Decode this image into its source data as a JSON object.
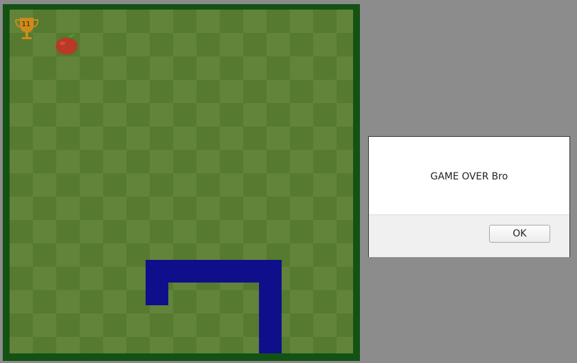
{
  "game": {
    "score": "11",
    "icons": {
      "trophy": "trophy-icon",
      "food": "apple-icon"
    },
    "colors": {
      "border": "#145214",
      "tile_light": "#62843a",
      "tile_dark": "#557a30",
      "snake": "#0f0f8c",
      "apple": "#c0392b"
    }
  },
  "dialog": {
    "message": "GAME OVER Bro",
    "ok_label": "OK"
  }
}
